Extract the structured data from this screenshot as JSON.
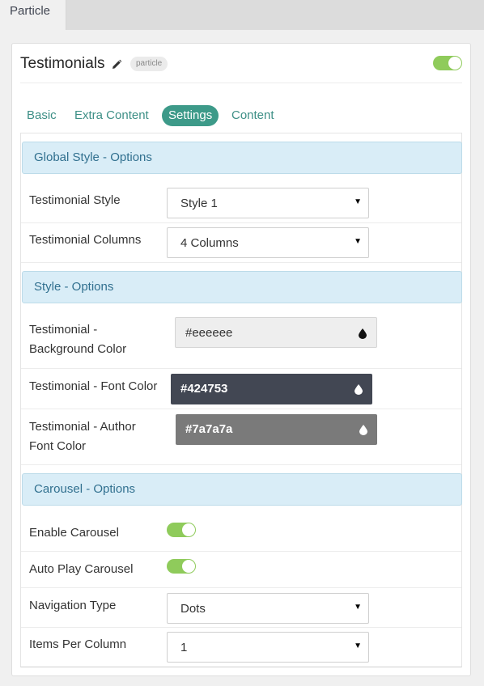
{
  "top_tab": {
    "label": "Particle"
  },
  "header": {
    "title": "Testimonials",
    "badge": "particle",
    "enabled": true
  },
  "tabs": [
    {
      "label": "Basic",
      "active": false
    },
    {
      "label": "Extra Content",
      "active": false
    },
    {
      "label": "Settings",
      "active": true
    },
    {
      "label": "Content",
      "active": false
    }
  ],
  "sections": {
    "global_style": {
      "title": "Global Style - Options",
      "testimonial_style": {
        "label": "Testimonial Style",
        "value": "Style 1"
      },
      "testimonial_columns": {
        "label": "Testimonial Columns",
        "value": "4 Columns"
      }
    },
    "style": {
      "title": "Style - Options",
      "background_color": {
        "label_line1": "Testimonial -",
        "label_line2": "Background Color",
        "value": "#eeeeee"
      },
      "font_color": {
        "label": "Testimonial - Font Color",
        "value": "#424753"
      },
      "author_font_color": {
        "label_line1": "Testimonial - Author",
        "label_line2": "Font Color",
        "value": "#7a7a7a"
      }
    },
    "carousel": {
      "title": "Carousel - Options",
      "enable_carousel": {
        "label": "Enable Carousel",
        "enabled": true
      },
      "auto_play": {
        "label": "Auto Play Carousel",
        "enabled": true
      },
      "navigation_type": {
        "label": "Navigation Type",
        "value": "Dots"
      },
      "items_per_column": {
        "label": "Items Per Column",
        "value": "1"
      }
    }
  },
  "colors": {
    "accent": "#3d9a89",
    "toggle_on": "#8fcb5b",
    "section_bg": "#d9edf7",
    "section_text": "#31708f"
  },
  "icons": {
    "edit": "pencil-icon",
    "color_picker": "drop-icon",
    "select": "caret-down-icon"
  }
}
